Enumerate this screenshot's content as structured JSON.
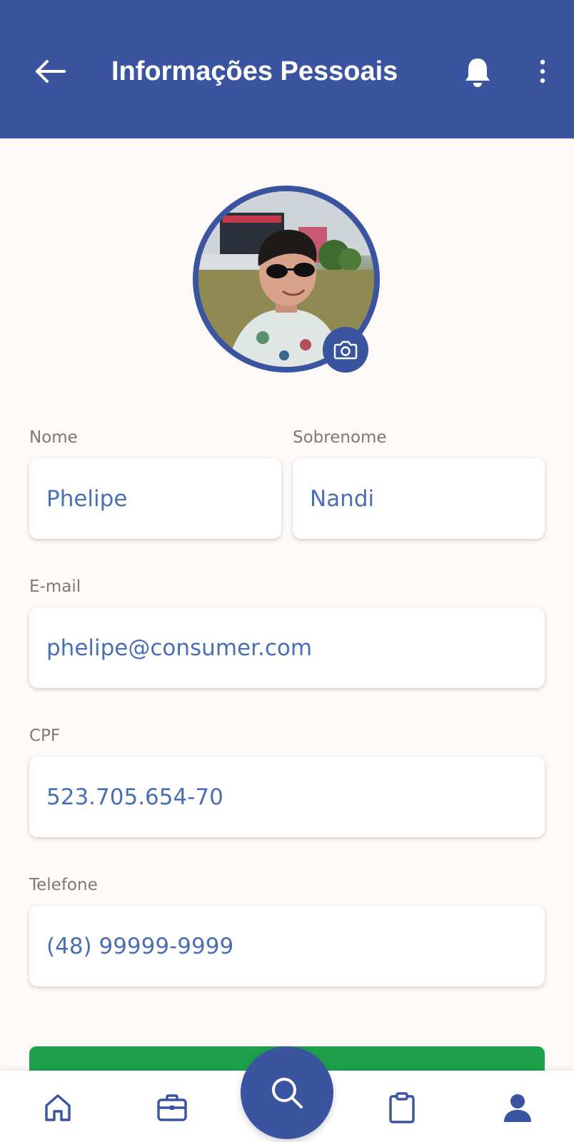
{
  "header": {
    "title": "Informações Pessoais",
    "back_icon": "arrow-left-icon",
    "notification_icon": "bell-icon",
    "menu_icon": "more-vertical-icon"
  },
  "profile": {
    "camera_icon": "camera-icon"
  },
  "form": {
    "first_name": {
      "label": "Nome",
      "value": "Phelipe"
    },
    "last_name": {
      "label": "Sobrenome",
      "value": "Nandi"
    },
    "email": {
      "label": "E-mail",
      "value": "phelipe@consumer.com"
    },
    "cpf": {
      "label": "CPF",
      "value": "523.705.654-70"
    },
    "phone": {
      "label": "Telefone",
      "value": "(48) 99999-9999"
    }
  },
  "bottom_nav": {
    "items": [
      {
        "icon": "home-icon"
      },
      {
        "icon": "briefcase-icon"
      },
      {
        "icon": "search-icon"
      },
      {
        "icon": "clipboard-icon"
      },
      {
        "icon": "user-icon"
      }
    ]
  },
  "colors": {
    "primary": "#3b54a0",
    "accent_green": "#1fa04b",
    "field_text": "#4a6fb5",
    "background": "#fcf9f6"
  }
}
